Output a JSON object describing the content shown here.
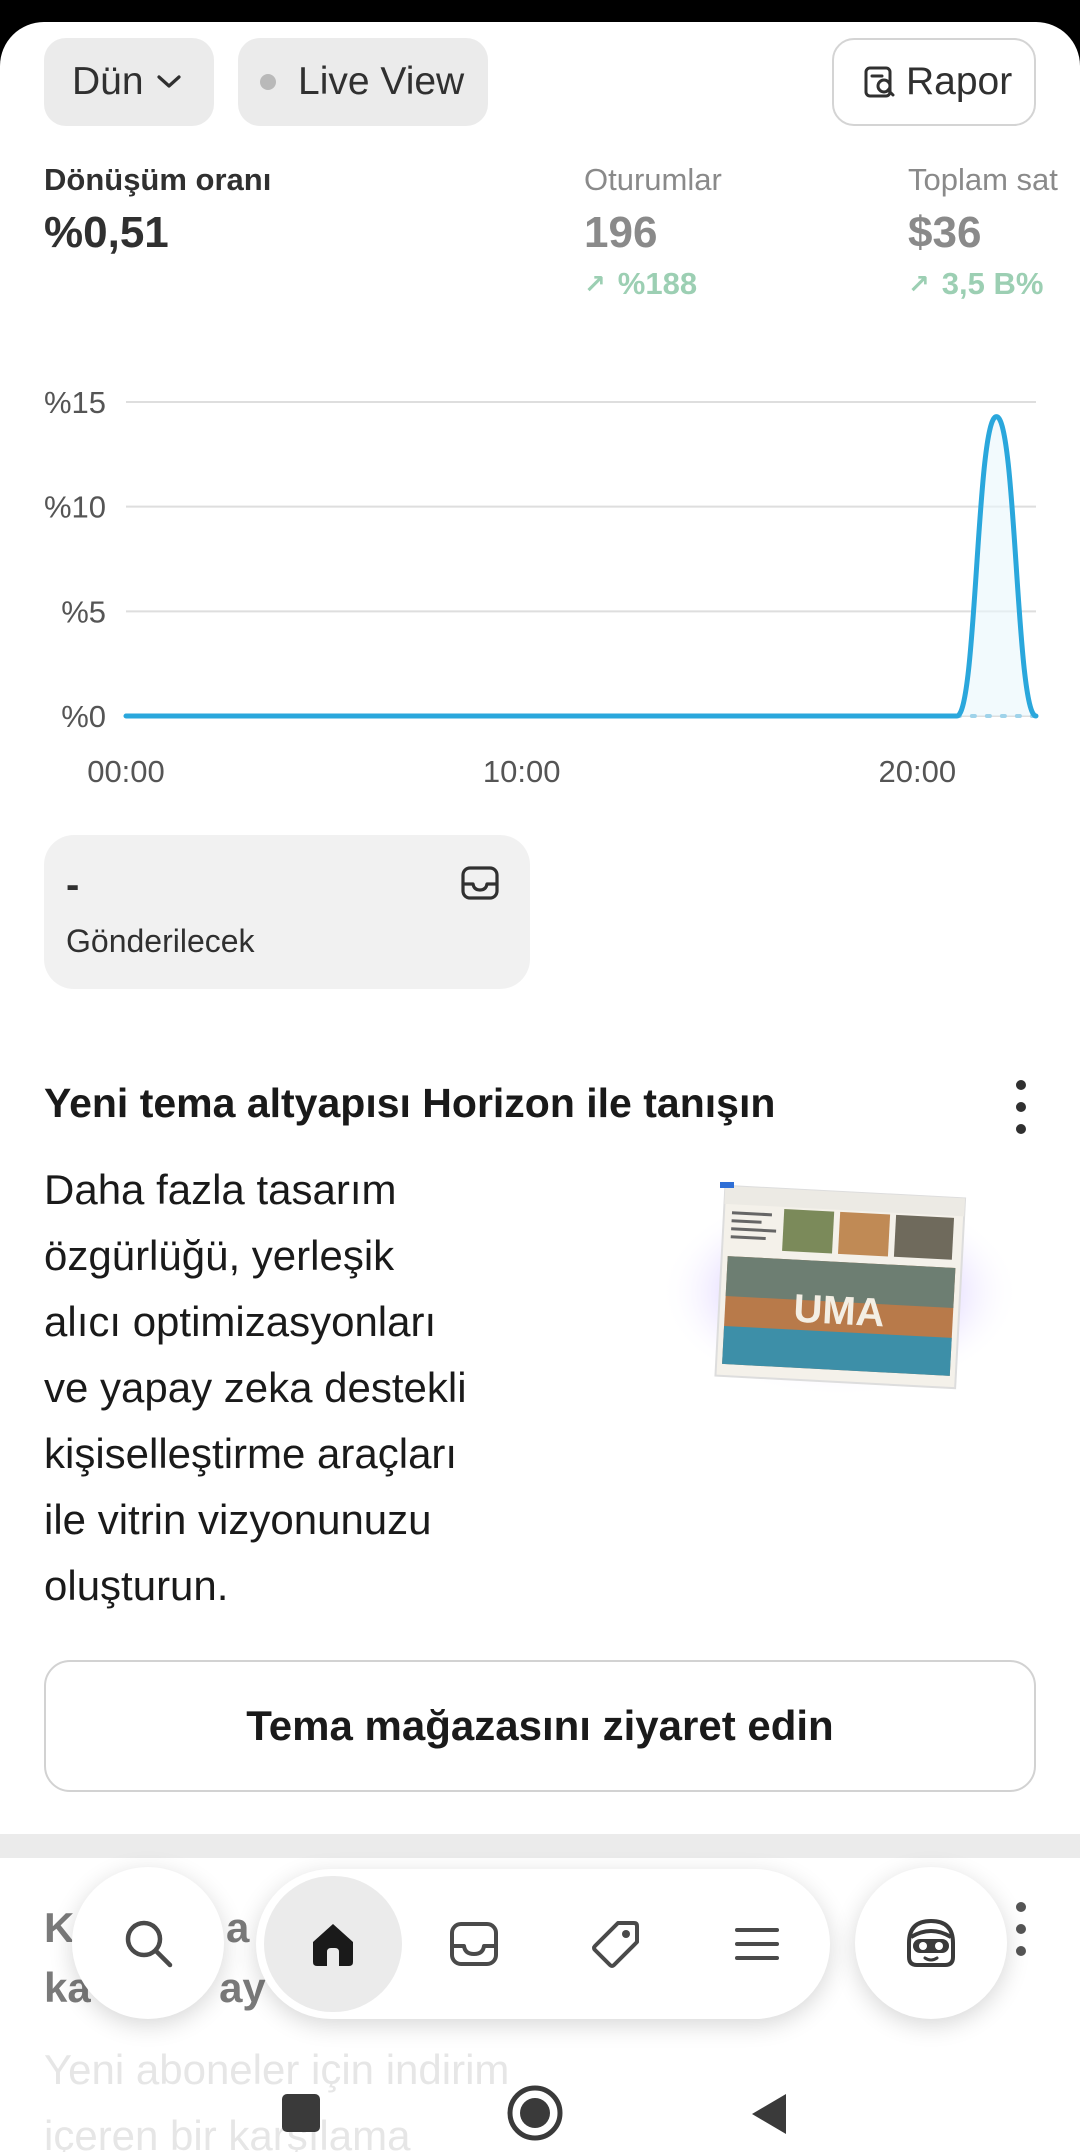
{
  "filters": {
    "date_label": "Dün",
    "live_label": "Live View",
    "report_label": "Rapor"
  },
  "metrics": {
    "conversion": {
      "label": "Dönüşüm oranı",
      "value": "%0,51"
    },
    "sessions": {
      "label": "Oturumlar",
      "value": "196",
      "change": "%188"
    },
    "sales": {
      "label": "Toplam sat",
      "value": "$36",
      "change": "3,5 B%"
    }
  },
  "chart_data": {
    "type": "line",
    "x_ticks": [
      "00:00",
      "10:00",
      "20:00"
    ],
    "y_ticks": [
      "%0",
      "%5",
      "%10",
      "%15"
    ],
    "ylim": [
      0,
      15
    ],
    "series": [
      {
        "color": "#2aa7dc",
        "x": [
          "00:00",
          "01:00",
          "02:00",
          "03:00",
          "04:00",
          "05:00",
          "06:00",
          "07:00",
          "08:00",
          "09:00",
          "10:00",
          "11:00",
          "12:00",
          "13:00",
          "14:00",
          "15:00",
          "16:00",
          "17:00",
          "18:00",
          "19:00",
          "20:00",
          "21:00",
          "22:00",
          "23:00"
        ],
        "values": [
          0,
          0,
          0,
          0,
          0,
          0,
          0,
          0,
          0,
          0,
          0,
          0,
          0,
          0,
          0,
          0,
          0,
          0,
          0,
          0,
          0,
          0,
          14.3,
          0
        ]
      }
    ],
    "grid": true
  },
  "fulfill": {
    "value": "-",
    "label": "Gönderilecek"
  },
  "promo": {
    "title": "Yeni tema altyapısı Horizon ile tanışın",
    "body_lines": [
      "Daha fazla tasarım",
      "özgürlüğü, yerleşik",
      "alıcı optimizasyonları",
      "ve yapay zeka destekli",
      "kişiselleştirme araçları",
      "ile vitrin vizyonunuzu",
      "oluşturun."
    ],
    "button_label": "Tema mağazasını ziyaret edin"
  },
  "next_card": {
    "title_line1": "K             a",
    "title_line2": "ka           ay",
    "body_line1": "Yeni aboneler için indirim",
    "body_line2": "içeren bir karşılama"
  },
  "nav": {
    "items": [
      "search-icon",
      "home-icon",
      "inbox-icon",
      "tag-icon",
      "menu-icon",
      "avatar-icon"
    ],
    "active": "home-icon"
  },
  "colors": {
    "accent": "#2aa7dc",
    "positive": "#9ccfb3",
    "text": "#303030"
  }
}
